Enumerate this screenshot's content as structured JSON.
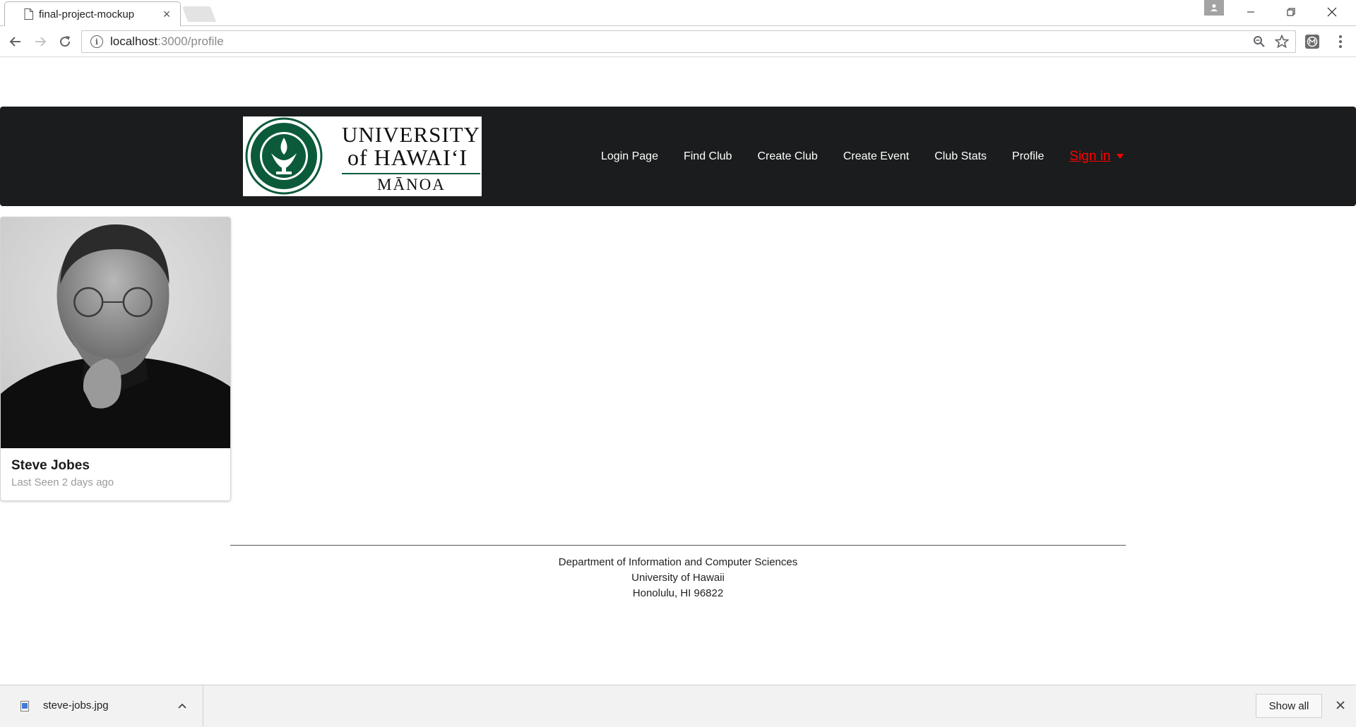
{
  "browser": {
    "tab_title": "final-project-mockup",
    "tab_close": "×",
    "url_host": "localhost",
    "url_path": ":3000/profile"
  },
  "site": {
    "logo": {
      "line1": "UNIVERSITY",
      "line2": "of HAWAI‘I",
      "line3": "MĀNOA",
      "seal_text": "UNIVERSITY OF HAWAI‘I · UA MAU KE EA O KA ‘ĀINA I KA PONO · 1907"
    },
    "menu": {
      "items": [
        "Login Page",
        "Find Club",
        "Create Club",
        "Create Event",
        "Club Stats",
        "Profile"
      ],
      "signin_label": "Sign in"
    }
  },
  "profile": {
    "name": "Steve Jobes",
    "meta": "Last Seen 2 days ago"
  },
  "footer": {
    "line1": "Department of Information and Computer Sciences",
    "line2": "University of Hawaii",
    "line3": "Honolulu, HI 96822"
  },
  "downloads": {
    "file_name": "steve-jobs.jpg",
    "show_all_label": "Show all"
  },
  "colors": {
    "header_bg": "#1b1c1d",
    "signin": "#ff0000",
    "uh_green": "#0b5b3a"
  },
  "icons": [
    "page-icon",
    "back-arrow-icon",
    "forward-arrow-icon",
    "reload-icon",
    "info-icon",
    "zoom-icon",
    "star-icon",
    "extension-icon",
    "menu-dots-icon",
    "user-icon",
    "minimize-icon",
    "restore-icon",
    "close-icon",
    "image-file-icon",
    "chevron-up-icon"
  ]
}
